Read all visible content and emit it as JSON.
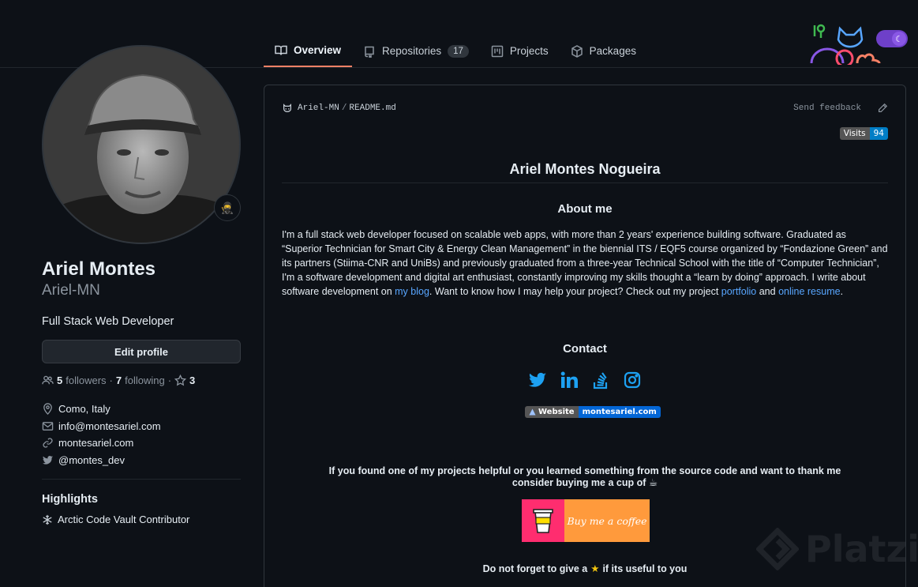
{
  "tabs": [
    {
      "label": "Overview",
      "icon": "book-icon",
      "active": true
    },
    {
      "label": "Repositories",
      "icon": "repo-icon",
      "count": "17"
    },
    {
      "label": "Projects",
      "icon": "project-icon"
    },
    {
      "label": "Packages",
      "icon": "package-icon"
    }
  ],
  "profile": {
    "fullname": "Ariel Montes",
    "login": "Ariel-MN",
    "bio": "Full Stack Web Developer",
    "edit_label": "Edit profile",
    "followers_count": "5",
    "followers_label": "followers",
    "following_count": "7",
    "following_label": "following",
    "stars": "3",
    "location": "Como, Italy",
    "email": "info@montesariel.com",
    "website": "montesariel.com",
    "twitter": "@montes_dev",
    "highlights_title": "Highlights",
    "highlight": "Arctic Code Vault Contributor"
  },
  "readme": {
    "owner": "Ariel-MN",
    "file": "README.md",
    "feedback": "Send feedback",
    "visits_label": "Visits",
    "visits_count": "94",
    "title": "Ariel Montes Nogueira",
    "about_heading": "About me",
    "about_p1": "I'm a full stack web developer focused on scalable web apps, with more than 2 years' experience building software. Graduated as “Superior Technician for Smart City & Energy Clean Management” in the biennial ITS / EQF5 course organized by “Fondazione Green” and its partners (Stiima-CNR and UniBs) and previously graduated from a three-year Technical School with the title of “Computer Technician”, I'm a software development and digital art enthusiast, constantly improving my skills thought a “learn by doing” approach. I write about software development on ",
    "blog_link": "my blog",
    "about_p2": ". Want to know how I may help your project? Check out my project ",
    "portfolio_link": "portfolio",
    "and": " and ",
    "resume_link": "online resume",
    "end": ".",
    "contact_heading": "Contact",
    "website_badge_label": "Website",
    "website_badge_value": "montesariel.com",
    "thanks_line1": "If you found one of my projects helpful or you learned something from the source code and want to thank me",
    "thanks_line2": "consider buying me a cup of ☕",
    "coffee_label": "Buy me a coffee",
    "star_before": "Do not forget to give a",
    "star_after": "if its useful to you"
  },
  "watermark": "Platzi",
  "colors": {
    "background": "#0d1117",
    "accent": "#f78166",
    "link": "#58a6ff",
    "twitter": "#1da1f2"
  }
}
